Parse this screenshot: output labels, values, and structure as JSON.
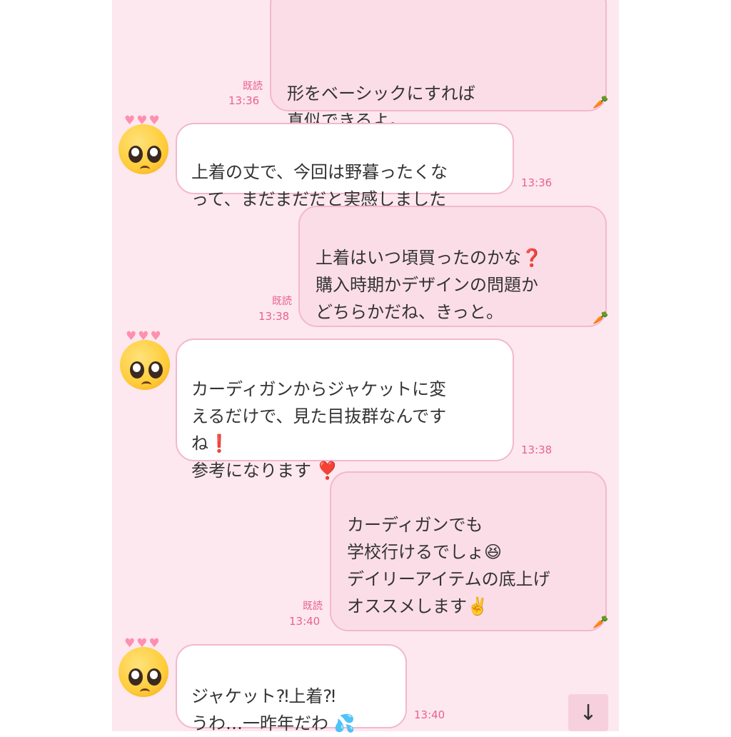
{
  "colors": {
    "chat_background": "#fde8ef",
    "outgoing_bubble": "#fbdde8",
    "incoming_bubble": "#ffffff",
    "bubble_border": "#f3b8cb",
    "timestamp": "#e8628f"
  },
  "read_label": "既読",
  "messages": [
    {
      "direction": "outgoing",
      "text": "形をベーシックにすれば\n真似できるよ。",
      "time": "13:36",
      "read": "既読",
      "sticker_icon": "carrot-icon"
    },
    {
      "direction": "incoming",
      "text": "上着の丈で、今回は野暮ったくな\nって、まだまだだと実感しました",
      "time": "13:36",
      "avatar_icon": "pleading-face-icon"
    },
    {
      "direction": "outgoing",
      "line1": "上着はいつ頃買ったのかな",
      "emoji1": "❓",
      "line2": "\n購入時期かデザインの問題か\nどちらかだね、きっと。",
      "time": "13:38",
      "read": "既読"
    },
    {
      "direction": "incoming",
      "line1": "カーディガンからジャケットに変\nえるだけで、見た目抜群なんです\nね",
      "emoji1": "❗",
      "line2": "参考になります",
      "emoji2": "❣️",
      "time": "13:38",
      "avatar_icon": "pleading-face-icon"
    },
    {
      "direction": "outgoing",
      "line1": "カーディガンでも\n学校行けるでしょ",
      "emoji1": "😆",
      "line2": "\nデイリーアイテムの底上げ\nオススメします",
      "emoji2": "✌️",
      "time": "13:40",
      "read": "既読"
    },
    {
      "direction": "incoming",
      "line1": "ジャケット⁈上着⁈\nうわ…一昨年だわ",
      "emoji1": "💦",
      "time": "13:40",
      "avatar_icon": "pleading-face-icon"
    }
  ],
  "carrot": "🥕",
  "scroll_down_icon": "↓"
}
